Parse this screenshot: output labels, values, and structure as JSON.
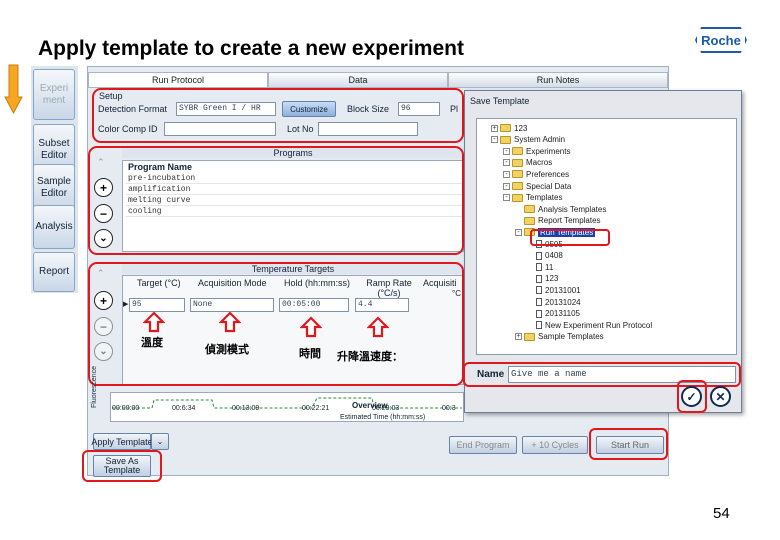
{
  "slide_title": "Apply template to create a new experiment",
  "logo_text": "Roche",
  "page_number": "54",
  "sidebar": {
    "items": [
      {
        "label": "Experi ment",
        "enabled": false
      },
      {
        "label": "Subset Editor",
        "enabled": true
      },
      {
        "label": "Sample Editor",
        "enabled": true
      },
      {
        "label": "Analysis",
        "enabled": true
      },
      {
        "label": "Report",
        "enabled": true
      }
    ]
  },
  "tabs": [
    "Run Protocol",
    "Data",
    "Run Notes"
  ],
  "setup": {
    "legend": "Setup",
    "detection_format_label": "Detection Format",
    "detection_format_value": "SYBR Green I / HR",
    "customize_label": "Customize",
    "block_size_label": "Block Size",
    "block_size_value": "96",
    "plate_label": "Pl",
    "color_comp_label": "Color Comp ID",
    "lot_no_label": "Lot No"
  },
  "programs": {
    "title": "Programs",
    "header": "Program Name",
    "rows": [
      "pre-incubation",
      "amplification",
      "melting curve",
      "cooling"
    ]
  },
  "temperature_targets": {
    "title": "Temperature Targets",
    "headers": [
      "Target (°C)",
      "Acquisition Mode",
      "Hold (hh:mm:ss)",
      "Ramp Rate (°C/s)",
      "Acquisiti"
    ],
    "unit_suffix": "°C",
    "row": {
      "target": "95",
      "mode": "None",
      "hold": "00:05:00",
      "ramp": "4.4"
    }
  },
  "annotations": [
    "溫度",
    "偵測模式",
    "時間",
    "升降溫速度："
  ],
  "chart": {
    "ylabel": "Fluorescence",
    "ticks": [
      "00:00:00",
      "00:6:34",
      "00:13:09",
      "00:22:21",
      "00:29:03",
      "00:3"
    ],
    "overview": "Overview",
    "estimated": "Estimated Time (hh:mm:ss)"
  },
  "bottom": {
    "apply_template": "Apply Template",
    "save_as_template": "Save As Template",
    "end_program": "End Program",
    "plus_10_cycles": "+ 10 Cycles",
    "start_run": "Start Run"
  },
  "dialog": {
    "title": "Save Template",
    "name_label": "Name",
    "name_value": "Give me a name",
    "ok_icon": "check-icon",
    "cancel_icon": "x-icon",
    "tree": [
      {
        "label": "123",
        "level": 0,
        "type": "folder",
        "toggle": "+"
      },
      {
        "label": "System Admin",
        "level": 0,
        "type": "folder",
        "toggle": "-"
      },
      {
        "label": "Experiments",
        "level": 1,
        "type": "folder",
        "toggle": "-"
      },
      {
        "label": "Macros",
        "level": 1,
        "type": "folder",
        "toggle": "-"
      },
      {
        "label": "Preferences",
        "level": 1,
        "type": "folder",
        "toggle": "-"
      },
      {
        "label": "Special Data",
        "level": 1,
        "type": "folder",
        "toggle": "-"
      },
      {
        "label": "Templates",
        "level": 1,
        "type": "folder",
        "toggle": "-"
      },
      {
        "label": "Analysis Templates",
        "level": 2,
        "type": "folder",
        "toggle": ""
      },
      {
        "label": "Report Templates",
        "level": 2,
        "type": "folder",
        "toggle": ""
      },
      {
        "label": "Run Templates",
        "level": 2,
        "type": "folder",
        "toggle": "-",
        "selected": true
      },
      {
        "label": "0505",
        "level": 3,
        "type": "file",
        "toggle": ""
      },
      {
        "label": "0408",
        "level": 3,
        "type": "file",
        "toggle": ""
      },
      {
        "label": "11",
        "level": 3,
        "type": "file",
        "toggle": ""
      },
      {
        "label": "123",
        "level": 3,
        "type": "file",
        "toggle": ""
      },
      {
        "label": "20131001",
        "level": 3,
        "type": "file",
        "toggle": ""
      },
      {
        "label": "20131024",
        "level": 3,
        "type": "file",
        "toggle": ""
      },
      {
        "label": "20131105",
        "level": 3,
        "type": "file",
        "toggle": ""
      },
      {
        "label": "New Experiment Run Protocol",
        "level": 3,
        "type": "file",
        "toggle": ""
      },
      {
        "label": "Sample Templates",
        "level": 2,
        "type": "folder",
        "toggle": "+"
      }
    ]
  }
}
